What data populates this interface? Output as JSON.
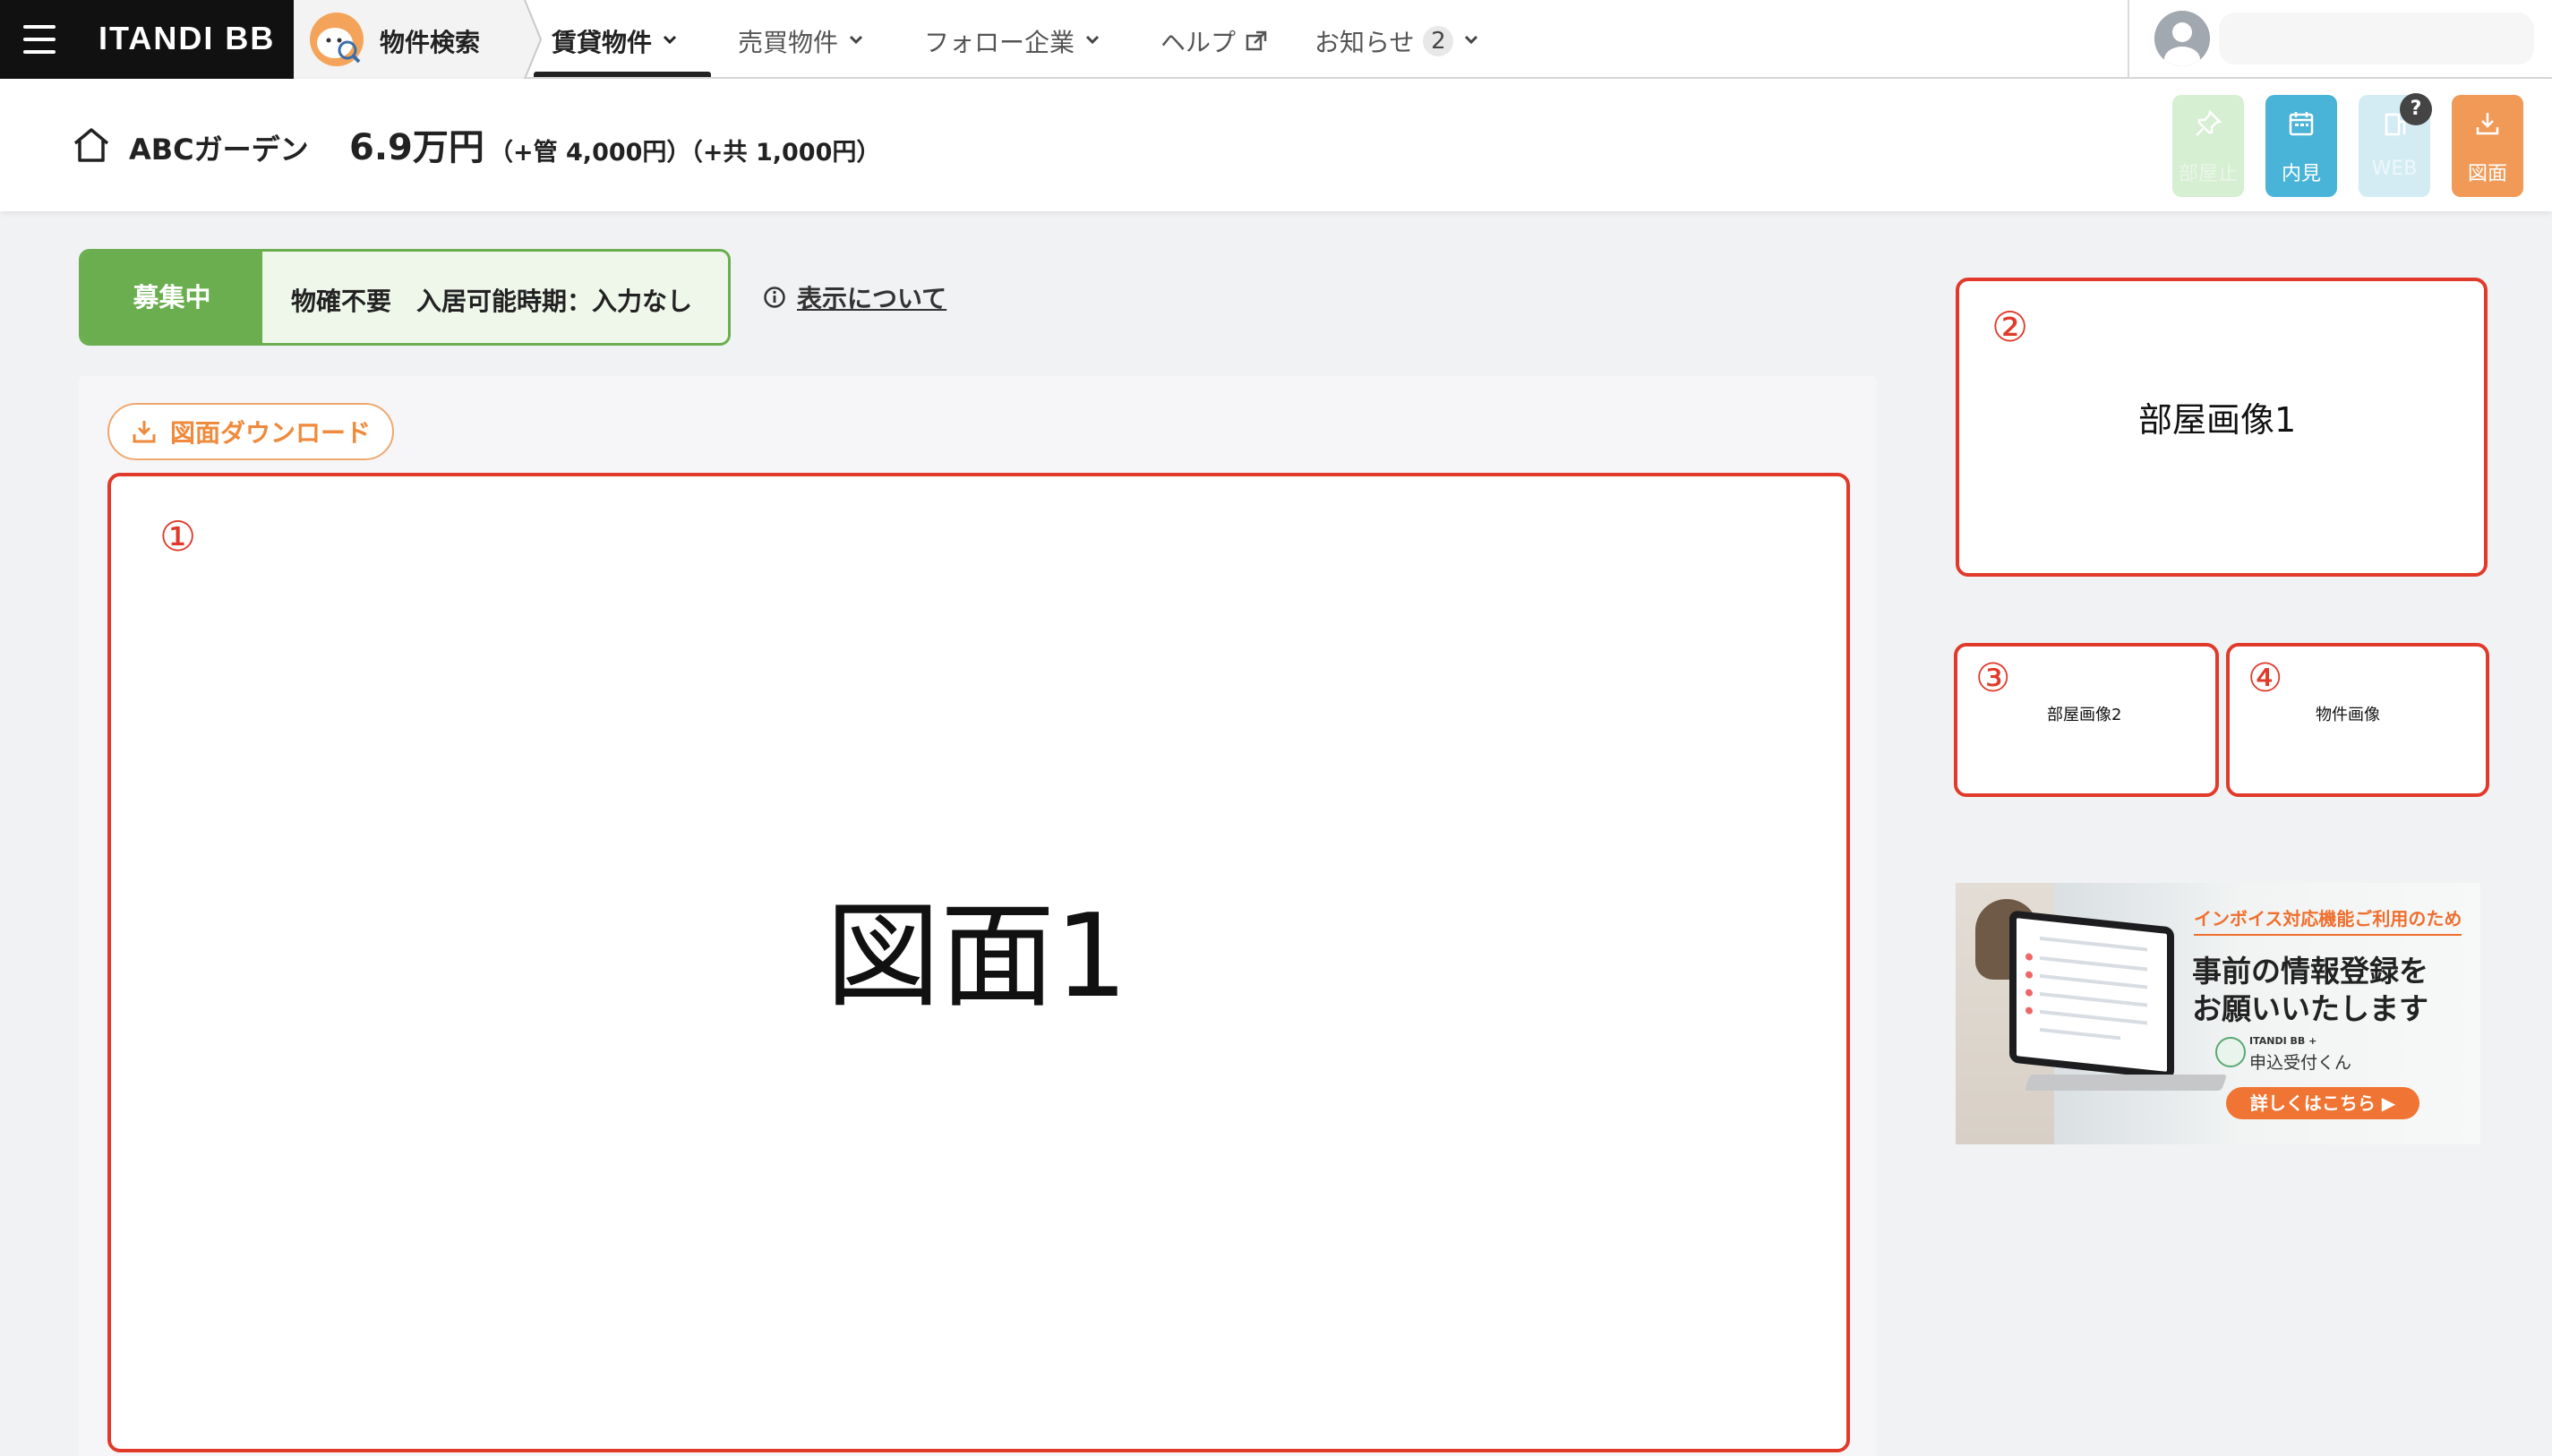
{
  "nav": {
    "brand": "ITANDI BB",
    "search_label": "物件検索",
    "items": [
      {
        "label": "賃貸物件"
      },
      {
        "label": "売買物件"
      },
      {
        "label": "フォロー企業"
      },
      {
        "label": "ヘルプ"
      },
      {
        "label": "お知らせ",
        "count": "2"
      }
    ]
  },
  "header": {
    "property_name": "ABCガーデン",
    "rent": "6.9万円",
    "fees": "（+管 4,000円）（+共 1,000円）",
    "actions": [
      {
        "label": "部屋止"
      },
      {
        "label": "内見"
      },
      {
        "label": "WEB",
        "help": "?"
      },
      {
        "label": "図面"
      }
    ]
  },
  "status": {
    "tag": "募集中",
    "text": "物確不要　入居可能時期：入力なし",
    "display_info": "表示について"
  },
  "plan": {
    "download_label": "図面ダウンロード",
    "main": {
      "num": "①",
      "label": "図面1"
    },
    "room1": {
      "num": "②",
      "label": "部屋画像1"
    },
    "room2": {
      "num": "③",
      "label": "部屋画像2"
    },
    "property": {
      "num": "④",
      "label": "物件画像"
    }
  },
  "banner": {
    "top": "インボイス対応機能ご利用のため",
    "head1": "事前の情報登録を",
    "head2": "お願いいたします",
    "app_small": "ITANDI BB +",
    "app_name": "申込受付くん",
    "cta": "詳しくはこちら ▶"
  },
  "colors": {
    "brand_dark": "#111111",
    "status_green": "#6aae4f",
    "frame_red": "#e13a2b",
    "download_orange": "#ef8a3c",
    "view_blue": "#4ab3d8"
  }
}
